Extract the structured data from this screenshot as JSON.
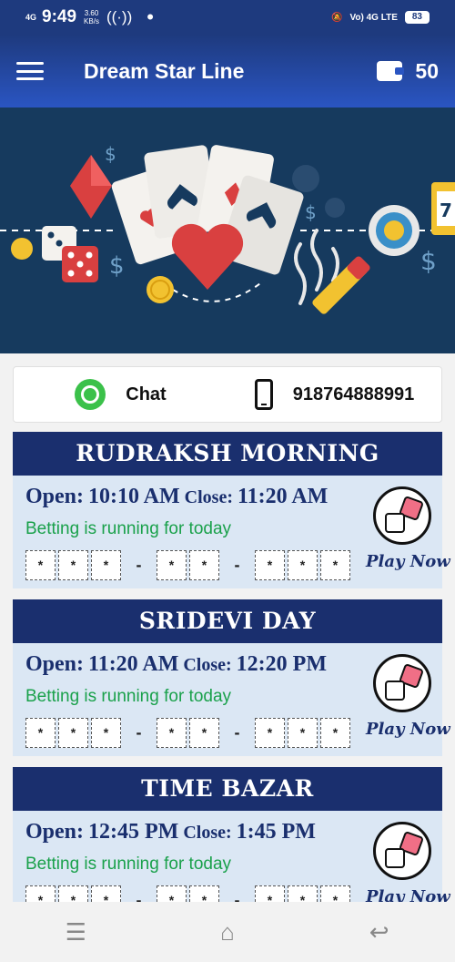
{
  "status_bar": {
    "network": "4G",
    "time": "9:49",
    "speed": "3.60",
    "speed_unit": "KB/s",
    "network_right": "Vo) 4G LTE",
    "battery": "83"
  },
  "app_bar": {
    "title": "Dream Star Line",
    "wallet_balance": "50",
    "menu_icon": "hamburger-icon",
    "wallet_icon": "wallet-icon"
  },
  "contact": {
    "chat_label": "Chat",
    "phone": "918764888991"
  },
  "games": [
    {
      "name": "RUDRAKSH MORNING",
      "open_label": "Open:",
      "open_time": "10:10 AM",
      "close_label": "Close:",
      "close_time": "11:20 AM",
      "status": "Betting is running for today",
      "result": [
        "*",
        "*",
        "*",
        "-",
        "*",
        "*",
        "-",
        "*",
        "*",
        "*"
      ],
      "play_label": "Play Now"
    },
    {
      "name": "SRIDEVI DAY",
      "open_label": "Open:",
      "open_time": "11:20 AM",
      "close_label": "Close:",
      "close_time": "12:20 PM",
      "status": "Betting is running for today",
      "result": [
        "*",
        "*",
        "*",
        "-",
        "*",
        "*",
        "-",
        "*",
        "*",
        "*"
      ],
      "play_label": "Play Now"
    },
    {
      "name": "TIME BAZAR",
      "open_label": "Open:",
      "open_time": "12:45 PM",
      "close_label": "Close:",
      "close_time": "1:45 PM",
      "status": "Betting is running for today",
      "result": [
        "*",
        "*",
        "*",
        "-",
        "*",
        "*",
        "-",
        "*",
        "*",
        "*"
      ],
      "play_label": "Play Now"
    }
  ],
  "colors": {
    "primary": "#1a2f6e",
    "appbar": "#2a55c2",
    "running_green": "#1aa14b",
    "card_bg": "#dbe7f4",
    "banner_bg": "#163a5e"
  }
}
